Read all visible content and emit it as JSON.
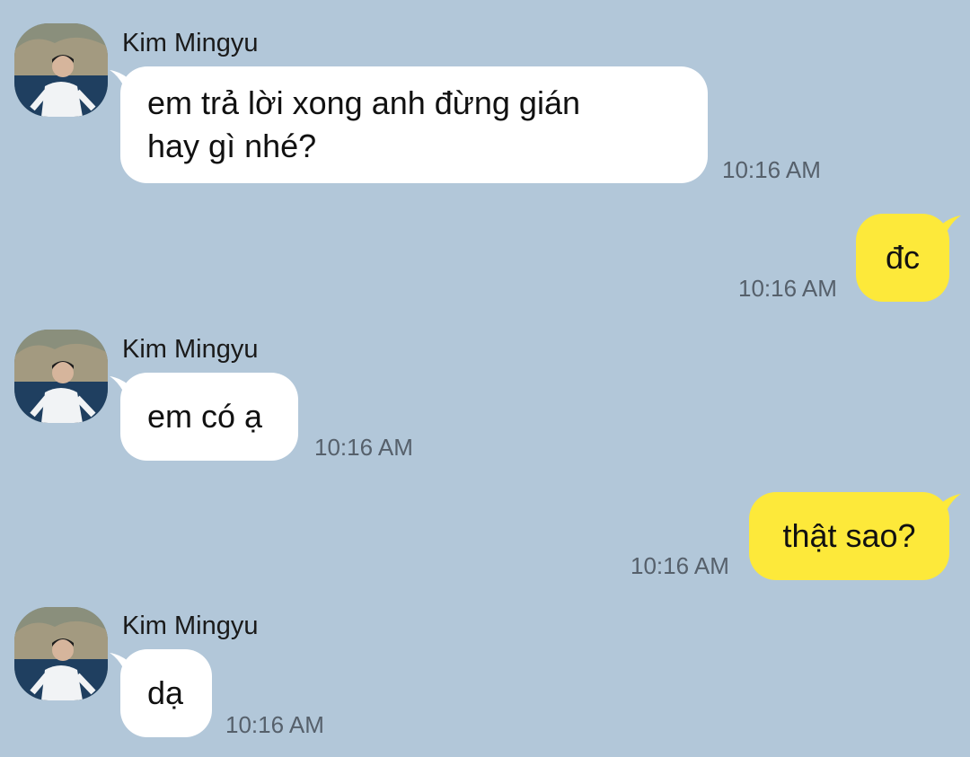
{
  "conversation": {
    "messages": [
      {
        "direction": "incoming",
        "sender": "Kim Mingyu",
        "lines": [
          "em trả lời xong anh đừng gián",
          "hay gì nhé?"
        ],
        "time": "10:16 AM"
      },
      {
        "direction": "outgoing",
        "lines": [
          "đc"
        ],
        "time": "10:16 AM"
      },
      {
        "direction": "incoming",
        "sender": "Kim Mingyu",
        "lines": [
          "em có ạ"
        ],
        "time": "10:16 AM"
      },
      {
        "direction": "outgoing",
        "lines": [
          "thật sao?"
        ],
        "time": "10:16 AM"
      },
      {
        "direction": "incoming",
        "sender": "Kim Mingyu",
        "lines": [
          "dạ"
        ],
        "time": "10:16 AM"
      }
    ]
  },
  "colors": {
    "background": "#b2c7d9",
    "incoming_bubble": "#ffffff",
    "outgoing_bubble": "#fde93a"
  },
  "icons": {
    "avatar": "profile-photo"
  }
}
